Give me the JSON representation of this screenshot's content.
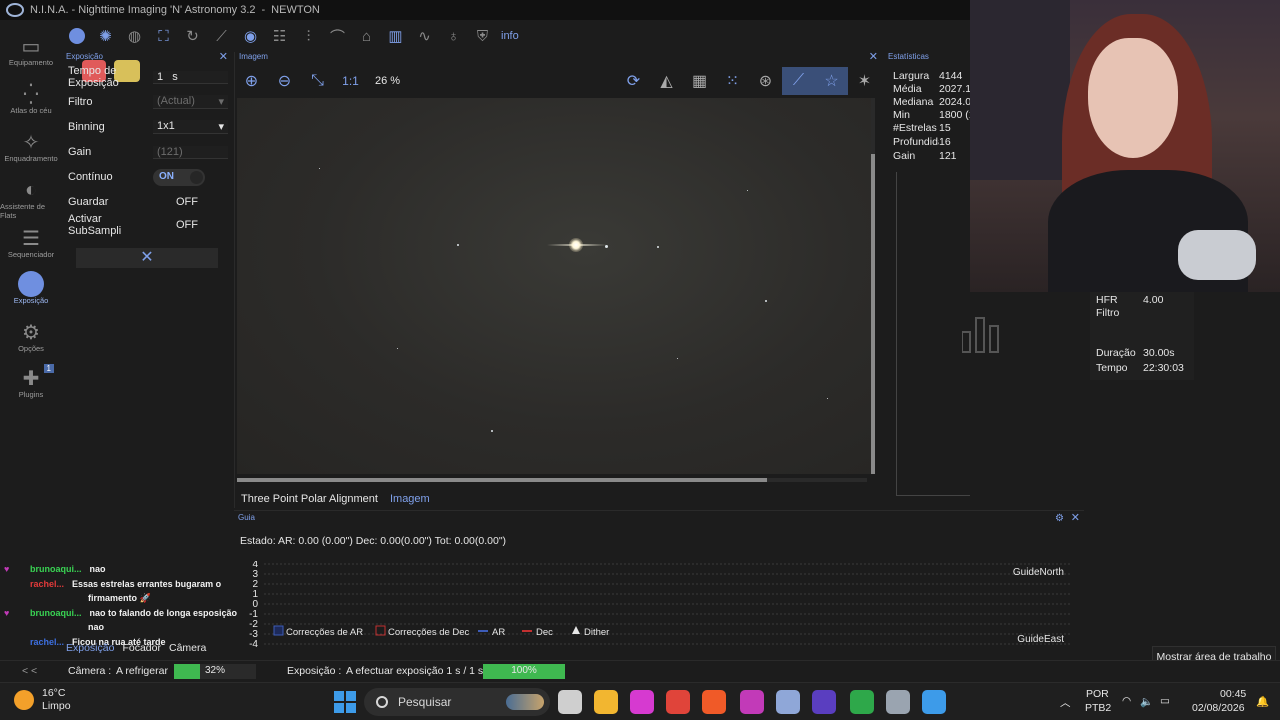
{
  "titlebar": {
    "app": "N.I.N.A. - Nighttime Imaging 'N' Astronomy 3.2",
    "profile": "NEWTON"
  },
  "nav": [
    {
      "label": "Equipamento",
      "icon": "camera-icon"
    },
    {
      "label": "Atlas do céu",
      "icon": "sky-atlas-icon"
    },
    {
      "label": "Enquadramento",
      "icon": "framing-icon"
    },
    {
      "label": "Assistente de Flats",
      "icon": "flat-wizard-icon"
    },
    {
      "label": "Sequenciador",
      "icon": "sequencer-icon"
    },
    {
      "label": "Exposição",
      "icon": "imaging-icon"
    },
    {
      "label": "Opções",
      "icon": "gear-icon"
    },
    {
      "label": "Plugins",
      "icon": "puzzle-icon",
      "badge": "1"
    }
  ],
  "toolbar": {
    "info_label": "info",
    "ratio_label": "1:1",
    "zoom": "26 %"
  },
  "exposure": {
    "title": "Exposição",
    "rows": [
      {
        "label": "Tempo de Exposição",
        "value": "1",
        "unit": "s"
      },
      {
        "label": "Filtro",
        "value": "(Actual)"
      },
      {
        "label": "Binning",
        "value": "1x1"
      },
      {
        "label": "Gain",
        "value": "(121)"
      },
      {
        "label": "Contínuo",
        "value": "ON"
      },
      {
        "label": "Guardar",
        "value": "OFF"
      },
      {
        "label": "Activar SubSampli",
        "value": "OFF"
      }
    ]
  },
  "image_panel": {
    "title": "Imagem",
    "tabs": [
      "Three Point Polar Alignment",
      "Imagem"
    ]
  },
  "stats": {
    "title": "Estatísticas",
    "rows": [
      {
        "k": "Largura",
        "v": "4144"
      },
      {
        "k": "Média",
        "v": "2027.15"
      },
      {
        "k": "Mediana",
        "v": "2024.00"
      },
      {
        "k": "Min",
        "v": "1800 (1"
      },
      {
        "k": "#Estrelas",
        "v": "15"
      },
      {
        "k": "Profundidade",
        "v": "16"
      },
      {
        "k": "Gain",
        "v": "121"
      }
    ]
  },
  "right_info": {
    "hfr_label": "HFR",
    "hfr_value": "4.00",
    "filter_label": "Filtro",
    "filter_value": "",
    "duration_label": "Duração",
    "duration_value": "30.00s",
    "time_label": "Tempo",
    "time_value": "22:30:03",
    "desktop_tip": "Mostrar área de trabalho"
  },
  "guide": {
    "title": "Guia",
    "state": "Estado:  AR: 0.00 (0.00\")  Dec: 0.00(0.00\")  Tot: 0.00(0.00\")",
    "north_label": "GuideNorth",
    "east_label": "GuideEast",
    "legend": [
      "Correcções de AR",
      "Correcções de Dec",
      "AR",
      "Dec",
      "Dither"
    ],
    "ticks": [
      "4",
      "3",
      "2",
      "1",
      "0",
      "-1",
      "-2",
      "-3",
      "-4"
    ]
  },
  "chat": [
    {
      "user": "brunoaqui...",
      "text": "nao",
      "color": "#39d353"
    },
    {
      "user": "rachel...",
      "text": "Essas estrelas errantes bugaram o",
      "text2": "firmamento 🚀",
      "color": "#e23a3a"
    },
    {
      "user": "brunoaqui...",
      "text": "nao to falando de longa esposição",
      "text2": "nao",
      "color": "#39d353"
    },
    {
      "user": "rachel...",
      "text": "Ficou na rua até tarde",
      "color": "#3d6fe0"
    }
  ],
  "bottom_tabs": [
    "Exposição",
    "Focador",
    "Câmera"
  ],
  "statusbar": {
    "collapse": "< <",
    "camera_label": "Câmera :",
    "camera_state": "A refrigerar",
    "camera_progress_label": "32%",
    "camera_progress": 0.32,
    "exposure_label": "Exposição :",
    "exposure_state": "A efectuar exposição 1 s / 1 s",
    "exposure_progress_label": "100%",
    "exposure_progress": 1.0
  },
  "taskbar": {
    "temp": "16°C",
    "weather": "Limpo",
    "search": "Pesquisar",
    "lang1": "POR",
    "lang2": "PTB2",
    "time": "00:45",
    "date": "02/08/2026",
    "apps": [
      {
        "name": "task-view-icon",
        "color": "#cfcfcf"
      },
      {
        "name": "file-explorer-icon",
        "color": "#f2b630"
      },
      {
        "name": "app-pink-icon",
        "color": "#d63ad0"
      },
      {
        "name": "chrome-icon",
        "color": "#e0443a"
      },
      {
        "name": "brave-icon",
        "color": "#f05a28"
      },
      {
        "name": "obsidian-icon",
        "color": "#c23ab8"
      },
      {
        "name": "nina-icon",
        "color": "#8fa7d8"
      },
      {
        "name": "stellarium-icon",
        "color": "#5a3ec0"
      },
      {
        "name": "phd2-icon",
        "color": "#2ea84a"
      },
      {
        "name": "app-grey-icon",
        "color": "#9aa4b0"
      },
      {
        "name": "app-blue-icon",
        "color": "#3d9be9"
      }
    ]
  },
  "accent": "#7fa0ea"
}
